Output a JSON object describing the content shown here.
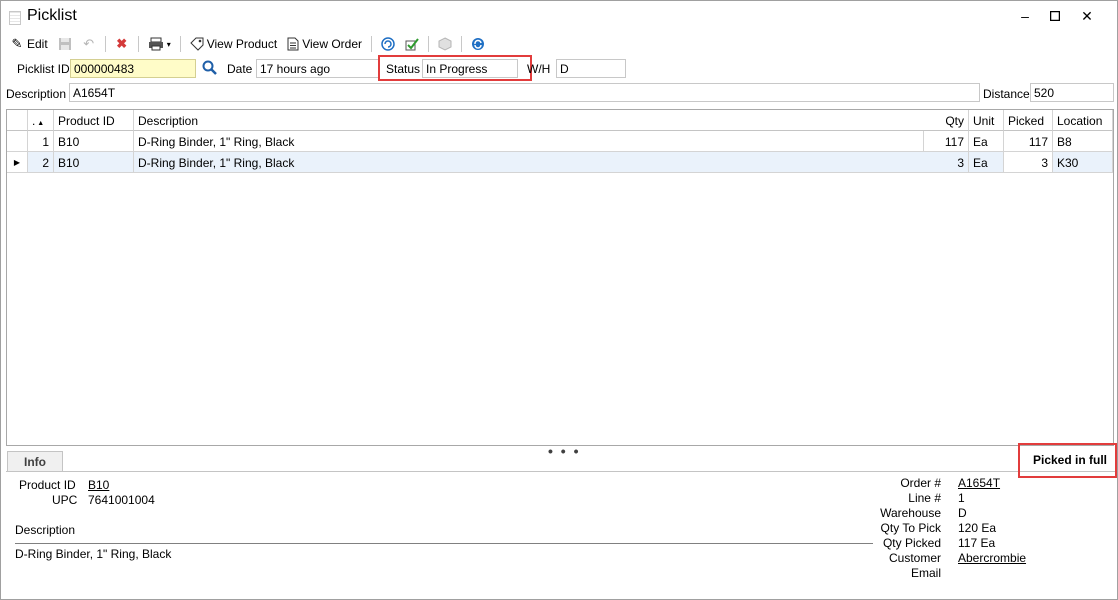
{
  "window": {
    "title": "Picklist"
  },
  "toolbar": {
    "edit_label": "Edit",
    "view_product_label": "View Product",
    "view_order_label": "View Order"
  },
  "header": {
    "picklist_id_label": "Picklist ID",
    "picklist_id_value": "000000483",
    "date_label": "Date",
    "date_value": "17 hours ago",
    "status_label": "Status",
    "status_value": "In Progress",
    "wh_label": "W/H",
    "wh_value": "D",
    "description_label": "Description",
    "description_value": "A1654T",
    "distance_label": "Distance",
    "distance_value": "520"
  },
  "grid": {
    "columns": [
      ".",
      "Product ID",
      "Description",
      "Qty",
      "Unit",
      "Picked",
      "Location"
    ],
    "rows": [
      {
        "n": "1",
        "product_id": "B10",
        "description": "D-Ring Binder, 1\" Ring, Black",
        "qty": "117",
        "unit": "Ea",
        "picked": "117",
        "location": "B8"
      },
      {
        "n": "2",
        "product_id": "B10",
        "description": "D-Ring Binder, 1\" Ring, Black",
        "qty": "3",
        "unit": "Ea",
        "picked": "3",
        "location": "K30"
      }
    ]
  },
  "info": {
    "tab_label": "Info",
    "status_text": "Picked in full",
    "product_id_label": "Product ID",
    "product_id_value": "B10",
    "upc_label": "UPC",
    "upc_value": "7641001004",
    "description_label": "Description",
    "description_value": "D-Ring Binder, 1\" Ring, Black",
    "order_label": "Order #",
    "order_value": "A1654T",
    "line_label": "Line #",
    "line_value": "1",
    "warehouse_label": "Warehouse",
    "warehouse_value": "D",
    "qty_to_pick_label": "Qty To Pick",
    "qty_to_pick_value": "120 Ea",
    "qty_picked_label": "Qty Picked",
    "qty_picked_value": "117 Ea",
    "customer_label": "Customer",
    "customer_value": "Abercrombie",
    "email_label": "Email",
    "email_value": ""
  },
  "colors": {
    "highlight": "#e23c3c",
    "picklist_id_bg": "#fffcc8",
    "selected_row": "#eaf2fb"
  }
}
